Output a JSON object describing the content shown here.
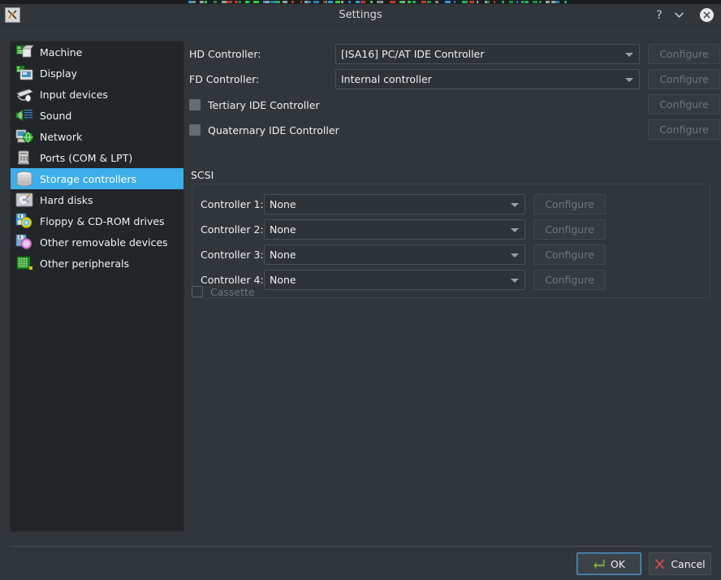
{
  "window": {
    "title": "Settings",
    "app_icon": "x-app-icon",
    "help_button": "?",
    "menu_button": "chevron-down-icon",
    "close_button": "close-icon"
  },
  "sidebar": {
    "items": [
      {
        "label": "Machine",
        "icon": "machine-icon",
        "selected": false
      },
      {
        "label": "Display",
        "icon": "display-icon",
        "selected": false
      },
      {
        "label": "Input devices",
        "icon": "input-devices-icon",
        "selected": false
      },
      {
        "label": "Sound",
        "icon": "sound-icon",
        "selected": false
      },
      {
        "label": "Network",
        "icon": "network-icon",
        "selected": false
      },
      {
        "label": "Ports (COM & LPT)",
        "icon": "ports-icon",
        "selected": false
      },
      {
        "label": "Storage controllers",
        "icon": "storage-controllers-icon",
        "selected": true
      },
      {
        "label": "Hard disks",
        "icon": "hard-disks-icon",
        "selected": false
      },
      {
        "label": "Floppy & CD-ROM drives",
        "icon": "floppy-cdrom-icon",
        "selected": false
      },
      {
        "label": "Other removable devices",
        "icon": "other-removable-icon",
        "selected": false
      },
      {
        "label": "Other peripherals",
        "icon": "other-peripherals-icon",
        "selected": false
      }
    ]
  },
  "main": {
    "hd_controller": {
      "label": "HD Controller:",
      "value": "[ISA16] PC/AT IDE Controller",
      "configure_label": "Configure"
    },
    "fd_controller": {
      "label": "FD Controller:",
      "value": "Internal controller",
      "configure_label": "Configure"
    },
    "tertiary_ide": {
      "label": "Tertiary IDE Controller",
      "checked": false,
      "configure_label": "Configure"
    },
    "quaternary_ide": {
      "label": "Quaternary IDE Controller",
      "checked": false,
      "configure_label": "Configure"
    },
    "scsi": {
      "title": "SCSI",
      "controllers": [
        {
          "label": "Controller 1:",
          "value": "None",
          "configure_label": "Configure"
        },
        {
          "label": "Controller 2:",
          "value": "None",
          "configure_label": "Configure"
        },
        {
          "label": "Controller 3:",
          "value": "None",
          "configure_label": "Configure"
        },
        {
          "label": "Controller 4:",
          "value": "None",
          "configure_label": "Configure"
        }
      ]
    },
    "cassette": {
      "label": "Cassette",
      "checked": false,
      "enabled": false
    }
  },
  "footer": {
    "ok_label": "OK",
    "ok_icon": "enter-arrow-icon",
    "cancel_label": "Cancel",
    "cancel_icon": "x-mark-icon"
  },
  "colors": {
    "window_bg": "#31363b",
    "list_bg": "#232629",
    "selection": "#3daee9",
    "text": "#eff0f1",
    "disabled_text": "#6e757b",
    "field_bg": "#2e3338",
    "focus_border": "#4d8fc0"
  }
}
